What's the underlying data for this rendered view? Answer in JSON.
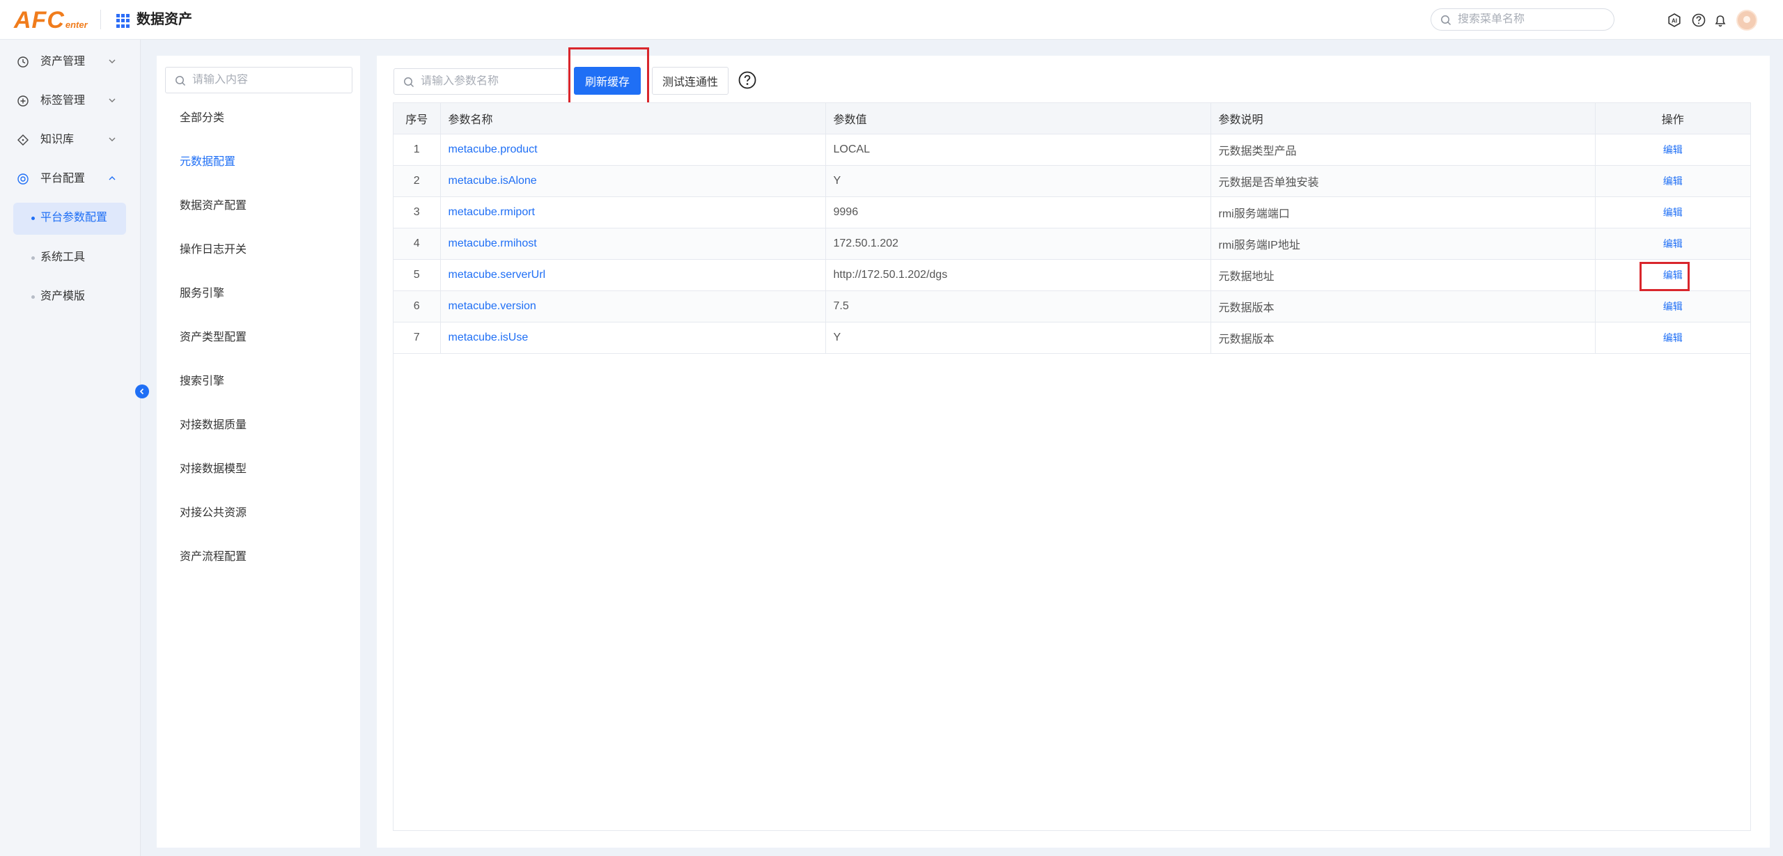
{
  "header": {
    "logo_big": "AFC",
    "logo_small": "enter",
    "app_title": "数据资产",
    "menu_search_placeholder": "搜索菜单名称"
  },
  "sidebar": {
    "items": [
      {
        "label": "资产管理",
        "icon": "clock-icon"
      },
      {
        "label": "标签管理",
        "icon": "plus-circle-icon"
      },
      {
        "label": "知识库",
        "icon": "diamond-icon"
      },
      {
        "label": "平台配置",
        "icon": "settings-ring-icon"
      }
    ],
    "subitems": [
      {
        "label": "平台参数配置",
        "active": true
      },
      {
        "label": "系统工具",
        "active": false
      },
      {
        "label": "资产模版",
        "active": false
      }
    ]
  },
  "categories": {
    "search_placeholder": "请输入内容",
    "items": [
      {
        "label": "全部分类",
        "active": false
      },
      {
        "label": "元数据配置",
        "active": true
      },
      {
        "label": "数据资产配置",
        "active": false
      },
      {
        "label": "操作日志开关",
        "active": false
      },
      {
        "label": "服务引擎",
        "active": false
      },
      {
        "label": "资产类型配置",
        "active": false
      },
      {
        "label": "搜索引擎",
        "active": false
      },
      {
        "label": "对接数据质量",
        "active": false
      },
      {
        "label": "对接数据模型",
        "active": false
      },
      {
        "label": "对接公共资源",
        "active": false
      },
      {
        "label": "资产流程配置",
        "active": false
      }
    ]
  },
  "toolbar": {
    "search_placeholder": "请输入参数名称",
    "refresh_label": "刷新缓存",
    "test_label": "测试连通性",
    "help_glyph": "?"
  },
  "table": {
    "headers": [
      "序号",
      "参数名称",
      "参数值",
      "参数说明",
      "操作"
    ],
    "rows": [
      {
        "no": "1",
        "name": "metacube.product",
        "value": "LOCAL",
        "desc": "元数据类型产品",
        "op": "编辑"
      },
      {
        "no": "2",
        "name": "metacube.isAlone",
        "value": "Y",
        "desc": "元数据是否单独安装",
        "op": "编辑"
      },
      {
        "no": "3",
        "name": "metacube.rmiport",
        "value": "9996",
        "desc": "rmi服务端端口",
        "op": "编辑"
      },
      {
        "no": "4",
        "name": "metacube.rmihost",
        "value": "172.50.1.202",
        "desc": "rmi服务端IP地址",
        "op": "编辑"
      },
      {
        "no": "5",
        "name": "metacube.serverUrl",
        "value": "http://172.50.1.202/dgs",
        "desc": "元数据地址",
        "op": "编辑"
      },
      {
        "no": "6",
        "name": "metacube.version",
        "value": "7.5",
        "desc": "元数据版本",
        "op": "编辑"
      },
      {
        "no": "7",
        "name": "metacube.isUse",
        "value": "Y",
        "desc": "元数据版本",
        "op": "编辑"
      }
    ]
  },
  "colors": {
    "accent": "#1f6ff5",
    "logo": "#f07c1c",
    "highlight": "#d9262c"
  }
}
